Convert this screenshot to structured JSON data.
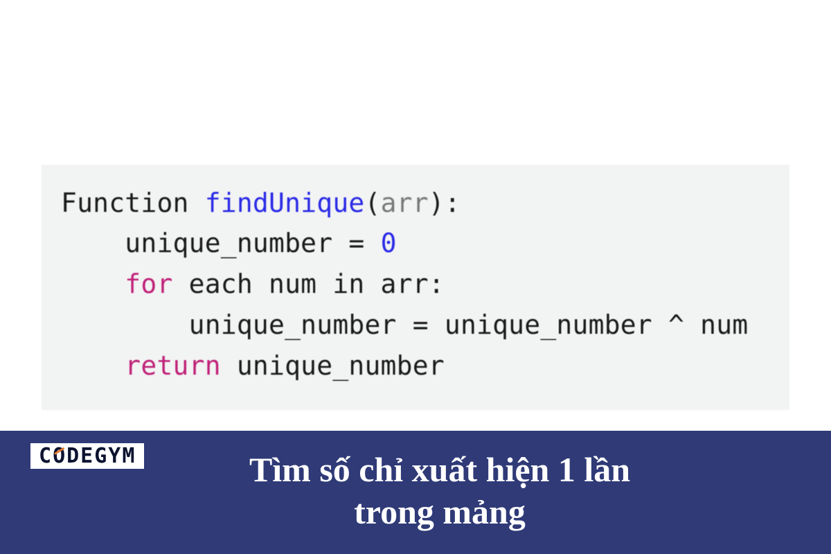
{
  "code": {
    "l1_kw": "Function",
    "l1_name": " findUnique",
    "l1_open": "(",
    "l1_arg": "arr",
    "l1_close": "):",
    "l2": "    unique_number = ",
    "l2_num": "0",
    "l3_for": "    for",
    "l3_rest": " each num in arr:",
    "l4": "        unique_number = unique_number ^ num",
    "l5_ret": "    return",
    "l5_rest": " unique_number"
  },
  "banner": {
    "logo_before": "C",
    "logo_accent": "O",
    "logo_after": "DEGYM",
    "title_line1": "Tìm số chỉ xuất hiện 1 lần",
    "title_line2": "trong mảng"
  }
}
